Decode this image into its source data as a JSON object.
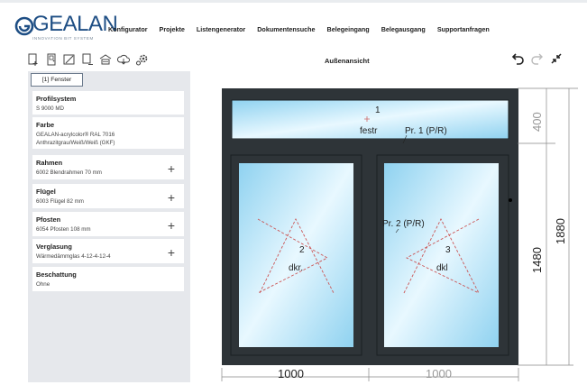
{
  "brand": {
    "name": "GEALAN",
    "tagline": "INNOVATION BIT SYSTEM",
    "color": "#1e4e84"
  },
  "nav": {
    "items": [
      "Konfigurator",
      "Projekte",
      "Listengenerator",
      "Dokumentensuche",
      "Belegeingang",
      "Belegausgang",
      "Supportanfragen"
    ]
  },
  "toolbar": {
    "icons": [
      "new-element-icon",
      "door-icon",
      "edit-element-icon",
      "document-plus-icon",
      "calculator-icon",
      "cloud-icon",
      "settings-icon"
    ]
  },
  "view_title": "Außenansicht",
  "tab": "[1] Fenster",
  "cards": [
    {
      "title": "Profilsystem",
      "lines": [
        "S 9000 MD"
      ],
      "plus": false
    },
    {
      "title": "Farbe",
      "lines": [
        "GEALAN-acrylcolor® RAL 7016",
        "Anthrazitgrau/Weiß/Weiß (GKF)"
      ],
      "plus": false
    },
    {
      "title": "Rahmen",
      "lines": [
        "6002 Blendrahmen 70 mm"
      ],
      "plus": true
    },
    {
      "title": "Flügel",
      "lines": [
        "6003 Flügel 82 mm"
      ],
      "plus": true
    },
    {
      "title": "Pfosten",
      "lines": [
        "6054 Pfosten 108 mm"
      ],
      "plus": true
    },
    {
      "title": "Verglasung",
      "lines": [
        "Wärmedämmglas 4-12-4-12-4"
      ],
      "plus": true
    },
    {
      "title": "Beschattung",
      "lines": [
        "Ohne"
      ],
      "plus": false
    }
  ],
  "window": {
    "top_pane": {
      "number": "1",
      "label": "festr",
      "profile": "Pr. 1 (P/R)"
    },
    "left_pane": {
      "number": "2",
      "label": "dkr."
    },
    "right_pane": {
      "number": "3",
      "label": "dkl",
      "profile": "Pr. 2 (P/R)"
    },
    "dimensions": {
      "width_left": "1000",
      "width_right": "1000",
      "height_top": "400",
      "height_bottom": "1480",
      "height_total": "1880"
    },
    "frame_color": "#2e3438",
    "glass_color": "#a8dcf3"
  }
}
